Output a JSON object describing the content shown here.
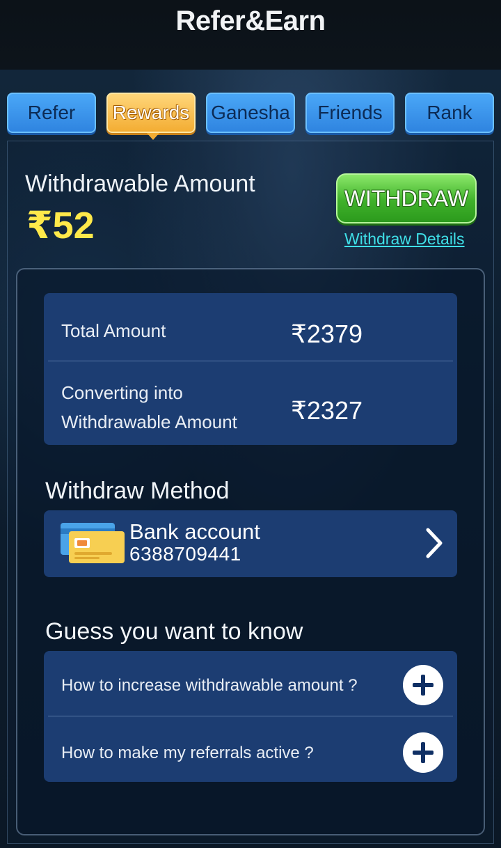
{
  "header": {
    "title": "Refer&Earn"
  },
  "tabs": [
    {
      "label": "Refer",
      "active": false
    },
    {
      "label": "Rewards",
      "active": true
    },
    {
      "label": "Ganesha",
      "active": false
    },
    {
      "label": "Friends",
      "active": false
    },
    {
      "label": "Rank",
      "active": false
    }
  ],
  "withdrawable": {
    "label": "Withdrawable Amount",
    "value": "₹52",
    "button_label": "WITHDRAW",
    "details_link": "Withdraw Details"
  },
  "amounts": {
    "total_label": "Total Amount",
    "total_value": "₹2379",
    "converting_label_line1": "Converting into",
    "converting_label_line2": "Withdrawable Amount",
    "converting_value": "₹2327"
  },
  "method": {
    "title": "Withdraw Method",
    "bank_name": "Bank account",
    "bank_number": "6388709441",
    "icon": "bank-card-icon"
  },
  "faq": {
    "title": "Guess you want to know",
    "items": [
      {
        "question": "How to increase withdrawable amount ?"
      },
      {
        "question": "How to make my referrals active ?"
      }
    ]
  },
  "colors": {
    "accent_yellow": "#ffe94a",
    "link_cyan": "#3fe0e8",
    "card_blue": "#1c3d72",
    "tab_blue": "#3a95ec",
    "tab_active": "#f3ad33",
    "withdraw_green": "#3fb12a"
  }
}
